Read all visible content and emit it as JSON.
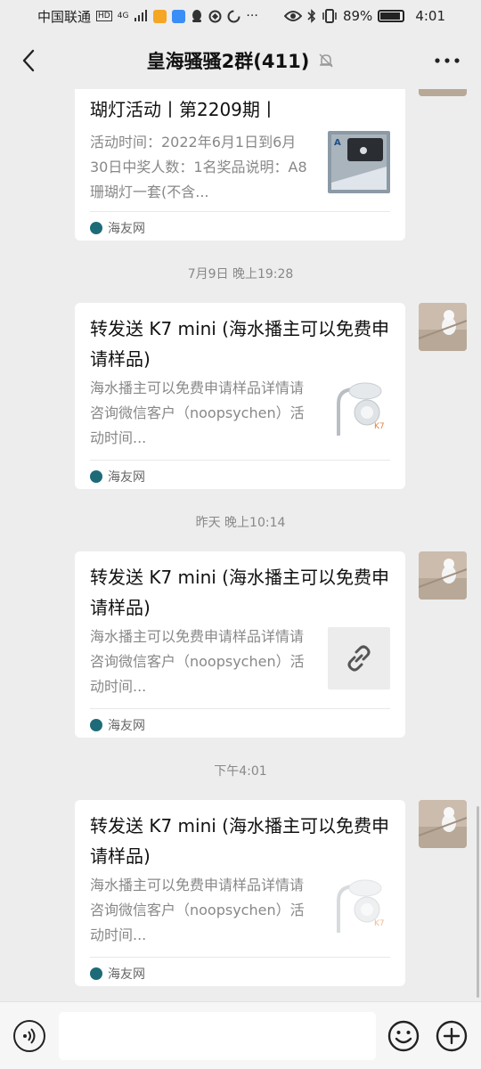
{
  "status_bar": {
    "carrier": "中国联通",
    "network": "4G",
    "battery": "89%",
    "time": "4:01"
  },
  "header": {
    "title": "皇海骚骚2群(411)"
  },
  "messages": [
    {
      "title": "瑚灯活动丨第2209期丨",
      "desc": "活动时间：2022年6月1日到6月30日中奖人数：1名奖品说明：A8珊瑚灯一套(不含...",
      "source": "海友网",
      "thumb": "a8-lamp-image"
    },
    {
      "time": "7月9日 晚上19:28",
      "title": "转发送 K7 mini (海水播主可以免费申请样品)",
      "desc": "海水播主可以免费申请样品详情请咨询微信客户（noopsychen）活动时间...",
      "source": "海友网",
      "thumb": "k7-lamp-image"
    },
    {
      "time": "昨天 晚上10:14",
      "title": "转发送 K7 mini (海水播主可以免费申请样品)",
      "desc": "海水播主可以免费申请样品详情请咨询微信客户（noopsychen）活动时间...",
      "source": "海友网",
      "thumb": "link-icon"
    },
    {
      "time": "下午4:01",
      "title": "转发送 K7 mini (海水播主可以免费申请样品)",
      "desc": "海水播主可以免费申请样品详情请咨询微信客户（noopsychen）活动时间...",
      "source": "海友网",
      "thumb": "k7-lamp-image"
    }
  ],
  "input": {
    "value": ""
  },
  "colors": {
    "background": "#ededed",
    "card": "#ffffff",
    "source_icon": "#1e6b78"
  }
}
